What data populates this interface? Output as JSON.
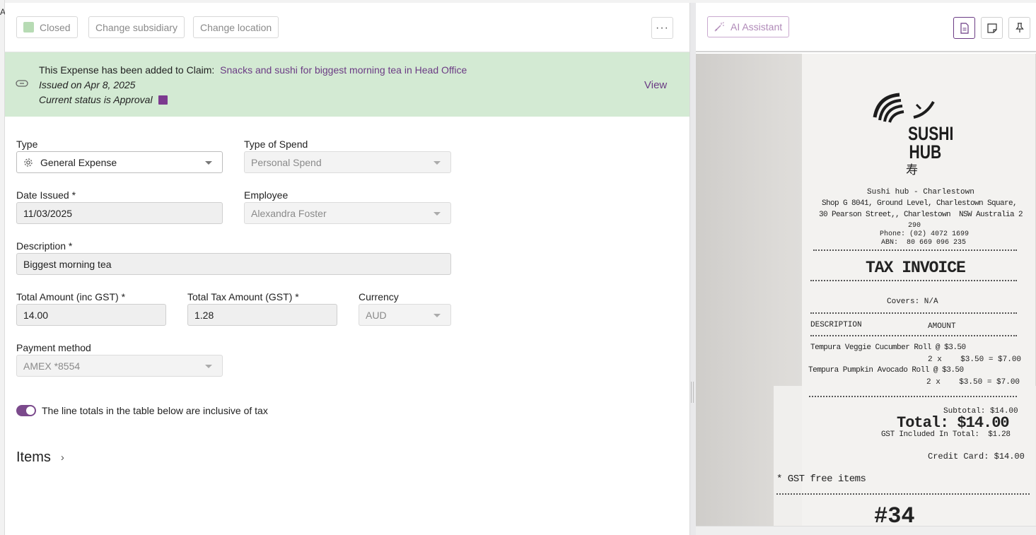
{
  "edge": {
    "letter": "A"
  },
  "toolbar": {
    "status_label": "Closed",
    "change_subsidiary_label": "Change subsidiary",
    "change_location_label": "Change location",
    "more_label": "···"
  },
  "banner": {
    "added_text": "This Expense has been added to Claim:",
    "claim_name": "Snacks and sushi for biggest morning tea in Head Office",
    "issued_text": "Issued on Apr 8, 2025",
    "status_text": "Current status is Approval",
    "view_label": "View",
    "status_color": "#7c3a8f"
  },
  "form": {
    "type": {
      "label": "Type",
      "value": "General Expense"
    },
    "type_of_spend": {
      "label": "Type of Spend",
      "value": "Personal Spend"
    },
    "date_issued": {
      "label": "Date Issued *",
      "value": "11/03/2025"
    },
    "employee": {
      "label": "Employee",
      "value": "Alexandra Foster"
    },
    "description": {
      "label": "Description *",
      "value": "Biggest morning tea"
    },
    "total_amount": {
      "label": "Total Amount (inc GST) *",
      "value": "14.00"
    },
    "total_tax": {
      "label": "Total Tax Amount (GST) *",
      "value": "1.28"
    },
    "currency": {
      "label": "Currency",
      "value": "AUD"
    },
    "payment_method": {
      "label": "Payment method",
      "value": "AMEX *8554"
    },
    "inclusive_toggle": {
      "label": "The line totals in the table below are inclusive of tax",
      "on": true
    }
  },
  "items": {
    "heading": "Items"
  },
  "right_toolbar": {
    "ai_label": "AI Assistant"
  },
  "receipt": {
    "brand_line1": "SUSHI",
    "brand_line2": "HUB",
    "brand_kanji": "寿",
    "store_name": "Sushi hub - Charlestown",
    "address1": "Shop G 8041, Ground Level, Charlestown Square,",
    "address2": "30 Pearson Street,, Charlestown  NSW Australia 2",
    "address3": "290",
    "phone": "Phone: (02) 4072 1699",
    "abn": "ABN:  80 669 096 235",
    "title": "TAX INVOICE",
    "covers": "Covers: N/A",
    "col_description": "DESCRIPTION",
    "col_amount": "AMOUNT",
    "item1_name": "Tempura Veggie Cucumber Roll @ $3.50",
    "item1_calc": "2 x    $3.50 = $7.00",
    "item2_name": "Tempura Pumpkin Avocado Roll @ $3.50",
    "item2_calc": "2 x    $3.50 = $7.00",
    "subtotal": "Subtotal: $14.00",
    "total": "Total: $14.00",
    "gst": "GST Included In Total:  $1.28",
    "credit": "Credit Card: $14.00",
    "gst_free": "* GST free items",
    "order_no": "#34"
  }
}
